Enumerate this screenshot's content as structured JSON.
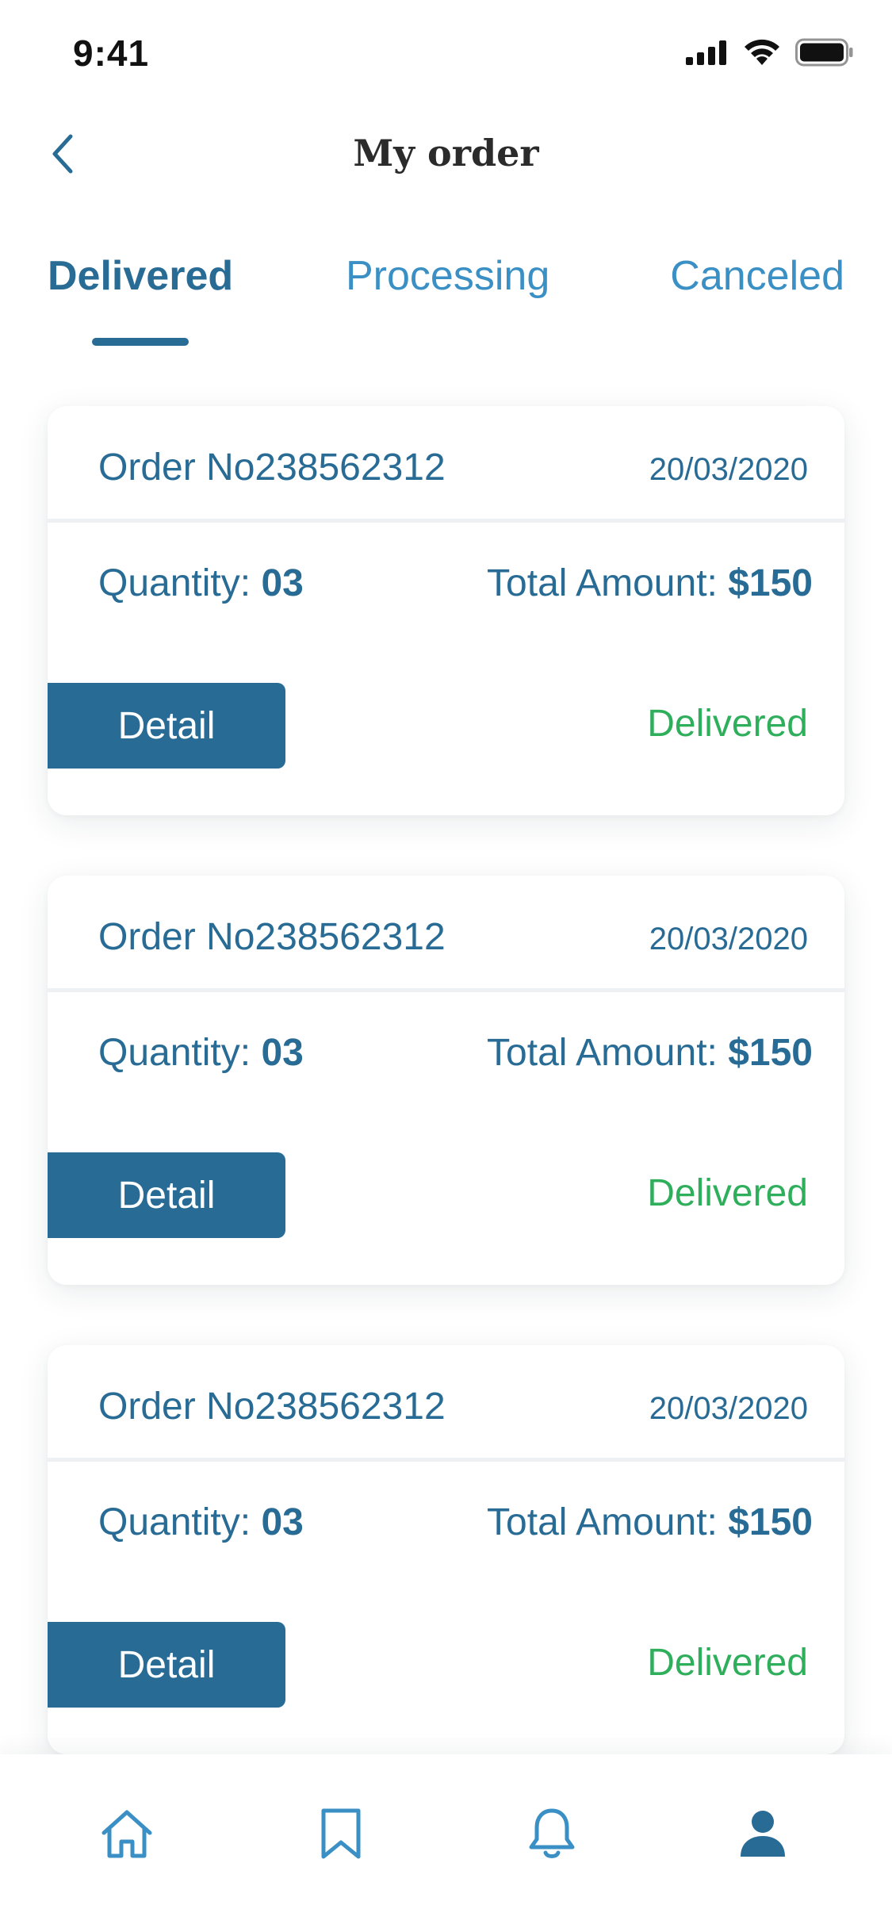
{
  "status_bar": {
    "time": "9:41"
  },
  "header": {
    "title": "My order",
    "back_icon": "chevron-left-icon"
  },
  "tabs": [
    {
      "label": "Delivered",
      "active": true
    },
    {
      "label": "Processing",
      "active": false
    },
    {
      "label": "Canceled",
      "active": false
    }
  ],
  "orders": [
    {
      "order_no": "Order No238562312",
      "date": "20/03/2020",
      "quantity_label": "Quantity:",
      "quantity_value": "03",
      "total_label": "Total Amount:",
      "total_value": "$150",
      "detail_label": "Detail",
      "status": "Delivered"
    },
    {
      "order_no": "Order No238562312",
      "date": "20/03/2020",
      "quantity_label": "Quantity:",
      "quantity_value": "03",
      "total_label": "Total Amount:",
      "total_value": "$150",
      "detail_label": "Detail",
      "status": "Delivered"
    },
    {
      "order_no": "Order No238562312",
      "date": "20/03/2020",
      "quantity_label": "Quantity:",
      "quantity_value": "03",
      "total_label": "Total Amount:",
      "total_value": "$150",
      "detail_label": "Detail",
      "status": "Delivered"
    }
  ],
  "bottom_nav": [
    {
      "icon": "home-icon"
    },
    {
      "icon": "bookmark-icon"
    },
    {
      "icon": "bell-icon"
    },
    {
      "icon": "profile-icon"
    }
  ],
  "colors": {
    "primary": "#286b95",
    "accent": "#3a90c5",
    "success": "#2fae5c",
    "title": "#2b2b2b"
  }
}
